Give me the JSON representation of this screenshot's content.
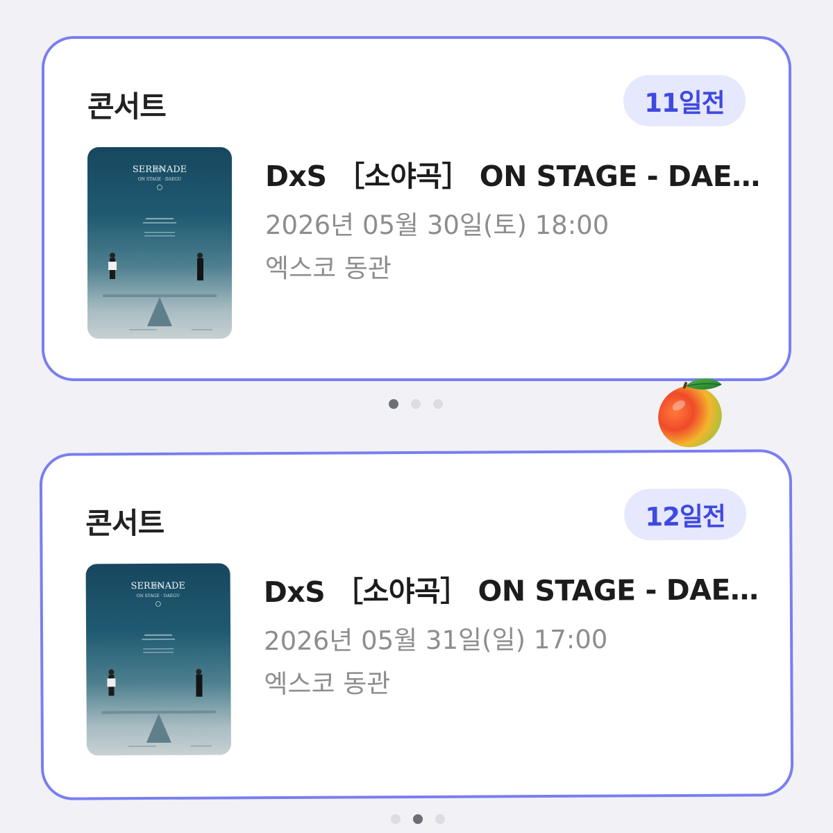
{
  "cards": [
    {
      "category": "콘서트",
      "dday": "11일전",
      "title": "DxS ［소야곡］ ON STAGE - DAEGU",
      "datetime": "2026년 05월 30일(토) 18:00",
      "venue": "엑스코 동관",
      "poster": {
        "brand": "DxS",
        "title": "SERENADE",
        "subtitle": "ON STAGE · DAEGU"
      }
    },
    {
      "category": "콘서트",
      "dday": "12일전",
      "title": "DxS ［소야곡］ ON STAGE - DAEGU",
      "datetime": "2026년 05월 31일(일) 17:00",
      "venue": "엑스코 동관",
      "poster": {
        "brand": "DxS",
        "title": "SERENADE",
        "subtitle": "ON STAGE · DAEGU"
      }
    }
  ],
  "pagers": [
    {
      "count": 3,
      "active_index": 0
    },
    {
      "count": 3,
      "active_index": 1
    }
  ],
  "colors": {
    "card_border": "#7a7ef0",
    "badge_bg": "#e6e8fd",
    "badge_text": "#3f49e0",
    "secondary_text": "#8d8d8d"
  },
  "decoration": {
    "sticker": "mango-emoji"
  }
}
